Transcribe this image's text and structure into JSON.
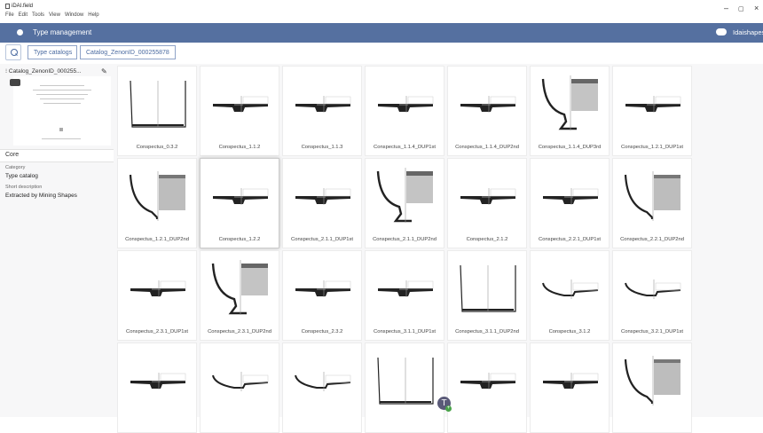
{
  "window": {
    "app_name": "iDAI.field",
    "menu": [
      "File",
      "Edit",
      "Tools",
      "View",
      "Window",
      "Help"
    ],
    "controls": [
      "–",
      "▢",
      "×"
    ]
  },
  "header": {
    "title": "Type management",
    "user": "Idaishapes",
    "bar_color": "#5570a0"
  },
  "breadcrumbs": [
    "Type catalogs",
    "Catalog_ZenonID_000255878"
  ],
  "sidebar": {
    "catalog_name": "Catalog_ZenonID_000255...",
    "section": "Core",
    "category_label": "Category",
    "category_value": "Type catalog",
    "description_label": "Short description",
    "description_value": "Extracted by Mining Shapes"
  },
  "types": [
    {
      "label": "Conspectus_0.3.2",
      "shape": "cup"
    },
    {
      "label": "Conspectus_1.1.2",
      "shape": "plate"
    },
    {
      "label": "Conspectus_1.1.3",
      "shape": "plate"
    },
    {
      "label": "Conspectus_1.1.4_DUP1st",
      "shape": "plate"
    },
    {
      "label": "Conspectus_1.1.4_DUP2nd",
      "shape": "plate"
    },
    {
      "label": "Conspectus_1.1.4_DUP3rd",
      "shape": "goblet"
    },
    {
      "label": "Conspectus_1.2.1_DUP1st",
      "shape": "plate"
    },
    {
      "label": "Conspectus_1.2.1_DUP2nd",
      "shape": "bowl"
    },
    {
      "label": "Conspectus_1.2.2",
      "shape": "plate"
    },
    {
      "label": "Conspectus_2.1.1_DUP1st",
      "shape": "plate"
    },
    {
      "label": "Conspectus_2.1.1_DUP2nd",
      "shape": "goblet"
    },
    {
      "label": "Conspectus_2.1.2",
      "shape": "plate"
    },
    {
      "label": "Conspectus_2.2.1_DUP1st",
      "shape": "plate"
    },
    {
      "label": "Conspectus_2.2.1_DUP2nd",
      "shape": "bowl"
    },
    {
      "label": "Conspectus_2.3.1_DUP1st",
      "shape": "plate"
    },
    {
      "label": "Conspectus_2.3.1_DUP2nd",
      "shape": "goblet"
    },
    {
      "label": "Conspectus_2.3.2",
      "shape": "plate"
    },
    {
      "label": "Conspectus_3.1.1_DUP1st",
      "shape": "plate"
    },
    {
      "label": "Conspectus_3.1.1_DUP2nd",
      "shape": "cup"
    },
    {
      "label": "Conspectus_3.1.2",
      "shape": "dish"
    },
    {
      "label": "Conspectus_3.2.1_DUP1st",
      "shape": "dish"
    },
    {
      "label": "",
      "shape": "plate"
    },
    {
      "label": "",
      "shape": "dish"
    },
    {
      "label": "",
      "shape": "dish"
    },
    {
      "label": "",
      "shape": "cup"
    },
    {
      "label": "",
      "shape": "plate"
    },
    {
      "label": "",
      "shape": "plate"
    },
    {
      "label": "",
      "shape": "bowl"
    }
  ],
  "selected_index": 8,
  "user_avatar": {
    "initial": "T",
    "plus": "+"
  }
}
